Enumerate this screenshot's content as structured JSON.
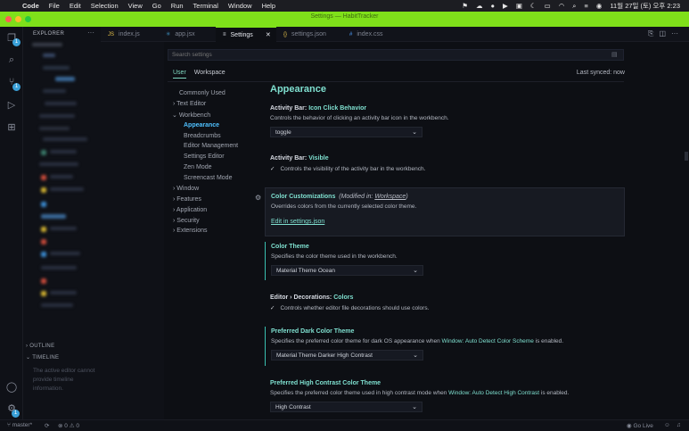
{
  "menubar": {
    "apple": "",
    "app": "Code",
    "items": [
      "File",
      "Edit",
      "Selection",
      "View",
      "Go",
      "Run",
      "Terminal",
      "Window",
      "Help"
    ],
    "clock": "11월 27일 (토) 오후 2:23"
  },
  "window": {
    "title": "Settings — HabitTracker"
  },
  "sidebar": {
    "title": "EXPLORER",
    "more": "···",
    "outline": "OUTLINE",
    "timeline": "TIMELINE",
    "timeline_msg": "The active editor cannot provide timeline information."
  },
  "activity": {
    "explorer_badge": "1",
    "scm_badge": "1",
    "settings_badge": "1"
  },
  "tabs": [
    {
      "label": "index.js",
      "icon": "js-icon",
      "color": "#e8c34a",
      "glyph": "JS"
    },
    {
      "label": "app.jsx",
      "icon": "react-icon",
      "color": "#4fc1ff",
      "glyph": "⚛"
    },
    {
      "label": "Settings",
      "icon": "settings-icon",
      "color": "#c8ccd4",
      "glyph": "≡"
    },
    {
      "label": "settings.json",
      "icon": "json-icon",
      "color": "#e8c34a",
      "glyph": "{}"
    },
    {
      "label": "index.css",
      "icon": "css-icon",
      "color": "#4fa0ff",
      "glyph": "#"
    }
  ],
  "tab_close": "✕",
  "settings": {
    "search_placeholder": "Search settings",
    "scope_user": "User",
    "scope_workspace": "Workspace",
    "last_synced": "Last synced: now",
    "toc": {
      "common": "Commonly Used",
      "text_editor": "Text Editor",
      "workbench": "Workbench",
      "appearance": "Appearance",
      "breadcrumbs": "Breadcrumbs",
      "editor_mgmt": "Editor Management",
      "settings_editor": "Settings Editor",
      "zen": "Zen Mode",
      "screencast": "Screencast Mode",
      "window": "Window",
      "features": "Features",
      "application": "Application",
      "security": "Security",
      "extensions": "Extensions"
    },
    "section_title": "Appearance",
    "s1": {
      "prefix": "Activity Bar: ",
      "key": "Icon Click Behavior",
      "desc": "Controls the behavior of clicking an activity bar icon in the workbench.",
      "value": "toggle"
    },
    "s2": {
      "prefix": "Activity Bar: ",
      "key": "Visible",
      "desc": "Controls the visibility of the activity bar in the workbench."
    },
    "s3": {
      "key": "Color Customizations",
      "mod_prefix": "(Modified in: ",
      "mod_link": "Workspace",
      "mod_suffix": ")",
      "desc": "Overrides colors from the currently selected color theme.",
      "edit": "Edit in settings.json"
    },
    "s4": {
      "key": "Color Theme",
      "desc": "Specifies the color theme used in the workbench.",
      "value": "Material Theme Ocean"
    },
    "s5": {
      "prefix": "Editor › Decorations: ",
      "key": "Colors",
      "desc": "Controls whether editor file decorations should use colors."
    },
    "s6": {
      "key": "Preferred Dark Color Theme",
      "desc1": "Specifies the preferred color theme for dark OS appearance when ",
      "link": "Window: Auto Detect Color Scheme",
      "desc2": " is enabled.",
      "value": "Material Theme Darker High Contrast"
    },
    "s7": {
      "key": "Preferred High Contrast Color Theme",
      "desc1": "Specifies the preferred color theme used in high contrast mode when ",
      "link": "Window: Auto Detect High Contrast",
      "desc2": " is enabled.",
      "value": "High Contrast"
    }
  },
  "status": {
    "branch": "master*",
    "problems": "0",
    "warnings": "0",
    "golive": "Go Live"
  },
  "colors": {
    "accent": "#7fe01a",
    "teal": "#7fe0d0"
  }
}
